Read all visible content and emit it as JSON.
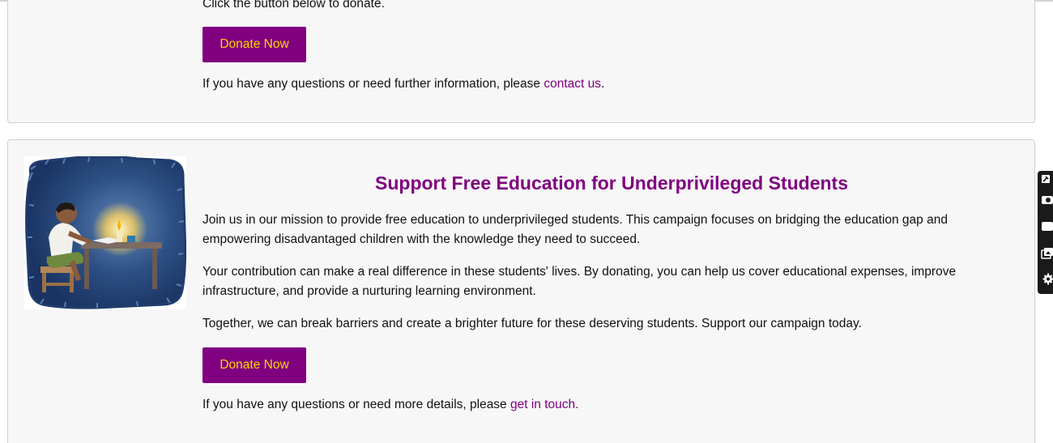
{
  "card_top": {
    "partial_text": "Click the button below to donate.",
    "donate_label": "Donate Now",
    "questions_text": "If you have any questions or need further information, please ",
    "contact_link": "contact us",
    "period": "."
  },
  "card_campaign": {
    "title": "Support Free Education for Underprivileged Students",
    "paragraph1": "Join us in our mission to provide free education to underprivileged students. This campaign focuses on bridging the education gap and empowering disadvantaged children with the knowledge they need to succeed.",
    "paragraph2": "Your contribution can make a real difference in these students' lives. By donating, you can help us cover educational expenses, improve infrastructure, and provide a nurturing learning environment.",
    "paragraph3": "Together, we can break barriers and create a brighter future for these deserving students. Support our campaign today.",
    "donate_label": "Donate Now",
    "details_text": "If you have any questions or need more details, please ",
    "touch_link": "get in touch.",
    "image_icon": "child-studying-by-candlelight-illustration"
  },
  "colors": {
    "accent": "#800080",
    "button_text": "#ffd400",
    "card_bg": "#f7f7f7"
  },
  "side_toolbar": {
    "icons": [
      "pin-icon",
      "camera-icon",
      "window-icon",
      "gallery-icon",
      "gear-icon"
    ]
  }
}
